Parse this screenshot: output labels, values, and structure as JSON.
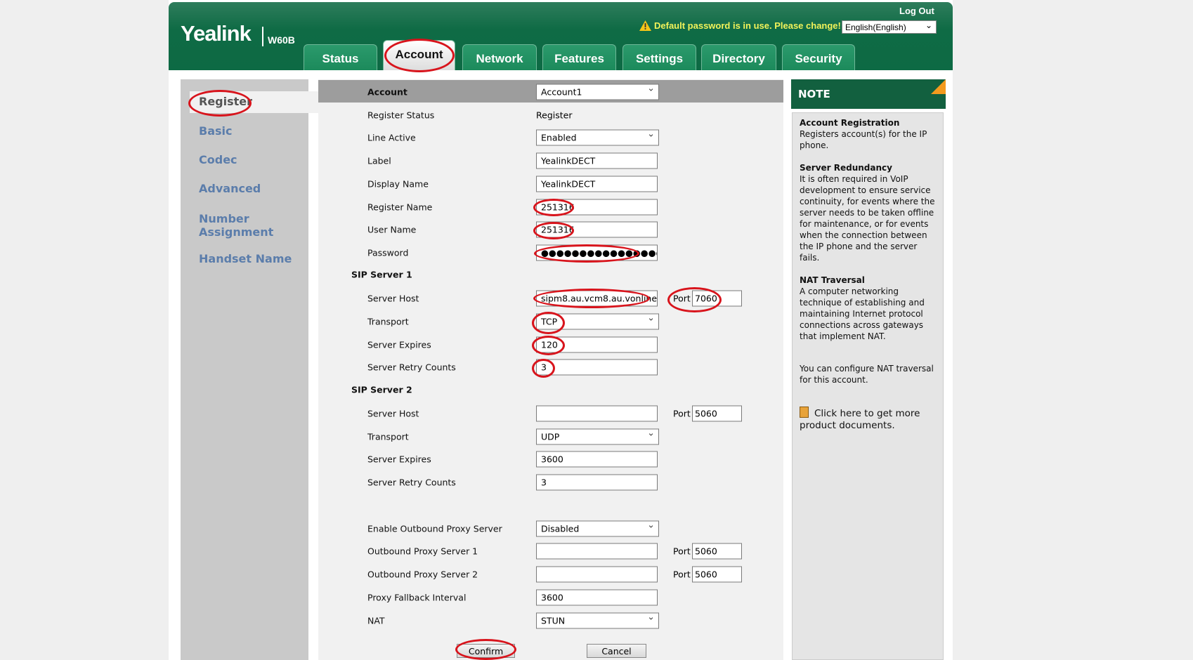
{
  "header": {
    "brand": "Yealink",
    "model": "W60B",
    "logout": "Log Out",
    "warning": "Default password is in use. Please change!",
    "language": "English(English)"
  },
  "tabs": [
    {
      "label": "Status"
    },
    {
      "label": "Account",
      "active": true
    },
    {
      "label": "Network"
    },
    {
      "label": "Features"
    },
    {
      "label": "Settings"
    },
    {
      "label": "Directory"
    },
    {
      "label": "Security"
    }
  ],
  "sidebar": {
    "items": [
      {
        "label": "Register",
        "active": true
      },
      {
        "label": "Basic"
      },
      {
        "label": "Codec"
      },
      {
        "label": "Advanced"
      },
      {
        "label": "Number Assignment"
      },
      {
        "label": "Handset Name"
      }
    ]
  },
  "form": {
    "rows": [
      {
        "type": "head",
        "label": "Account",
        "value": "Account1",
        "kind": "select"
      },
      {
        "label": "Register Status",
        "value": "Register",
        "kind": "text"
      },
      {
        "label": "Line Active",
        "value": "Enabled",
        "kind": "select"
      },
      {
        "label": "Label",
        "value": "YealinkDECT",
        "kind": "input"
      },
      {
        "label": "Display Name",
        "value": "YealinkDECT",
        "kind": "input"
      },
      {
        "label": "Register Name",
        "value": "251316",
        "kind": "input"
      },
      {
        "label": "User Name",
        "value": "251316",
        "kind": "input"
      },
      {
        "label": "Password",
        "value": "●●●●●●●●●●●●●●●●",
        "kind": "input"
      },
      {
        "type": "section",
        "label": "SIP Server 1"
      },
      {
        "label": "Server Host",
        "value": "sipm8.au.vcm8.au.vonline",
        "kind": "input",
        "port_label": "Port",
        "port": "7060"
      },
      {
        "label": "Transport",
        "value": "TCP",
        "kind": "select"
      },
      {
        "label": "Server Expires",
        "value": "120",
        "kind": "input"
      },
      {
        "label": "Server Retry Counts",
        "value": "3",
        "kind": "input"
      },
      {
        "type": "section",
        "label": "SIP Server 2"
      },
      {
        "label": "Server Host",
        "value": "",
        "kind": "input",
        "port_label": "Port",
        "port": "5060"
      },
      {
        "label": "Transport",
        "value": "UDP",
        "kind": "select"
      },
      {
        "label": "Server Expires",
        "value": "3600",
        "kind": "input"
      },
      {
        "label": "Server Retry Counts",
        "value": "3",
        "kind": "input"
      },
      {
        "label": "Enable Outbound Proxy Server",
        "value": "Disabled",
        "kind": "select"
      },
      {
        "label": "Outbound Proxy Server 1",
        "value": "",
        "kind": "input",
        "port_label": "Port",
        "port": "5060"
      },
      {
        "label": "Outbound Proxy Server 2",
        "value": "",
        "kind": "input",
        "port_label": "Port",
        "port": "5060"
      },
      {
        "label": "Proxy Fallback Interval",
        "value": "3600",
        "kind": "input"
      },
      {
        "label": "NAT",
        "value": "STUN",
        "kind": "select"
      }
    ],
    "confirm": "Confirm",
    "cancel": "Cancel"
  },
  "note": {
    "title": "NOTE",
    "sections": [
      {
        "heading": "Account Registration",
        "text": "Registers account(s) for the IP phone."
      },
      {
        "heading": "Server Redundancy",
        "text": "It is often required in VoIP development to ensure service continuity, for events where the server needs to be taken offline for maintenance, or for events when the connection between the IP phone and the server fails."
      },
      {
        "heading": "NAT Traversal",
        "text": "A computer networking technique of establishing and maintaining Internet protocol connections across gateways that implement NAT."
      },
      {
        "heading": "",
        "text": "You can configure NAT traversal for this account."
      }
    ],
    "docs_link": "Click here to get more product documents."
  },
  "colors": {
    "header_green": "#0f6b45",
    "note_green": "#12603f",
    "annotation_red": "#d8141c",
    "sidebar_link": "#5b7dab"
  }
}
